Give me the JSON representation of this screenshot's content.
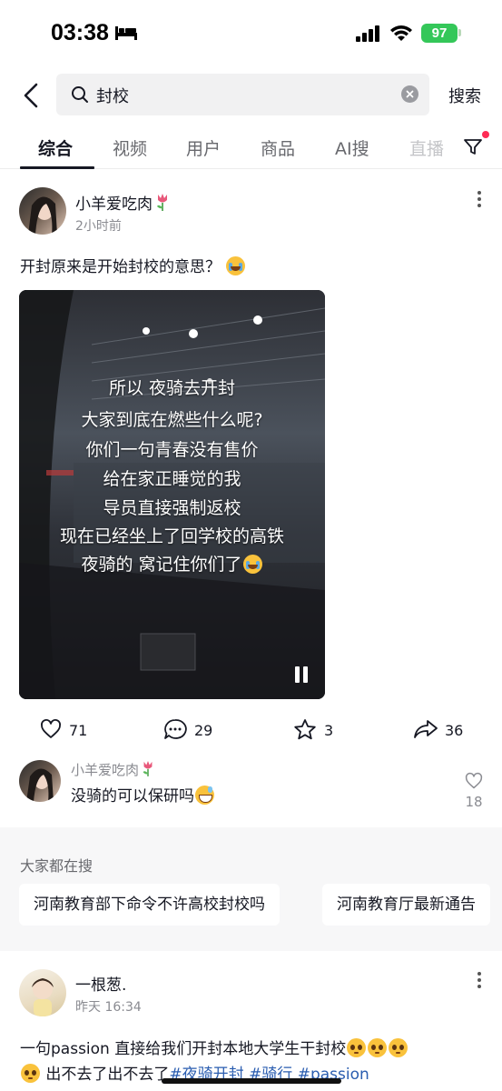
{
  "status": {
    "time": "03:38",
    "battery": "97"
  },
  "search": {
    "query": "封校",
    "submit_label": "搜索"
  },
  "tabs": [
    {
      "label": "综合"
    },
    {
      "label": "视频"
    },
    {
      "label": "用户"
    },
    {
      "label": "商品"
    },
    {
      "label": "AI搜"
    },
    {
      "label": "直播"
    }
  ],
  "post1": {
    "author": "小羊爱吃肉",
    "time": "2小时前",
    "text": "开封原来是开始封校的意思？",
    "video_caption": [
      "所以 夜骑去开封",
      "大家到底在燃些什么呢?",
      "你们一句青春没有售价",
      "给在家正睡觉的我",
      "导员直接强制返校",
      "现在已经坐上了回学校的高铁",
      "夜骑的 窝记住你们了"
    ],
    "likes": "71",
    "comments": "29",
    "favorites": "3",
    "shares": "36"
  },
  "comment": {
    "author": "小羊爱吃肉",
    "text": "没骑的可以保研吗",
    "likes": "18"
  },
  "suggest": {
    "title": "大家都在搜",
    "items": [
      "河南教育部下命令不许高校封校吗",
      "河南教育厅最新通告"
    ]
  },
  "post2": {
    "author": "一根葱.",
    "time": "昨天 16:34",
    "text_line1": "一句passion  直接给我们开封本地大学生干封校",
    "text_line2_plain": " 出不去了出不去了",
    "tags": [
      "#夜骑开封",
      "#骑行",
      "#passion"
    ]
  }
}
